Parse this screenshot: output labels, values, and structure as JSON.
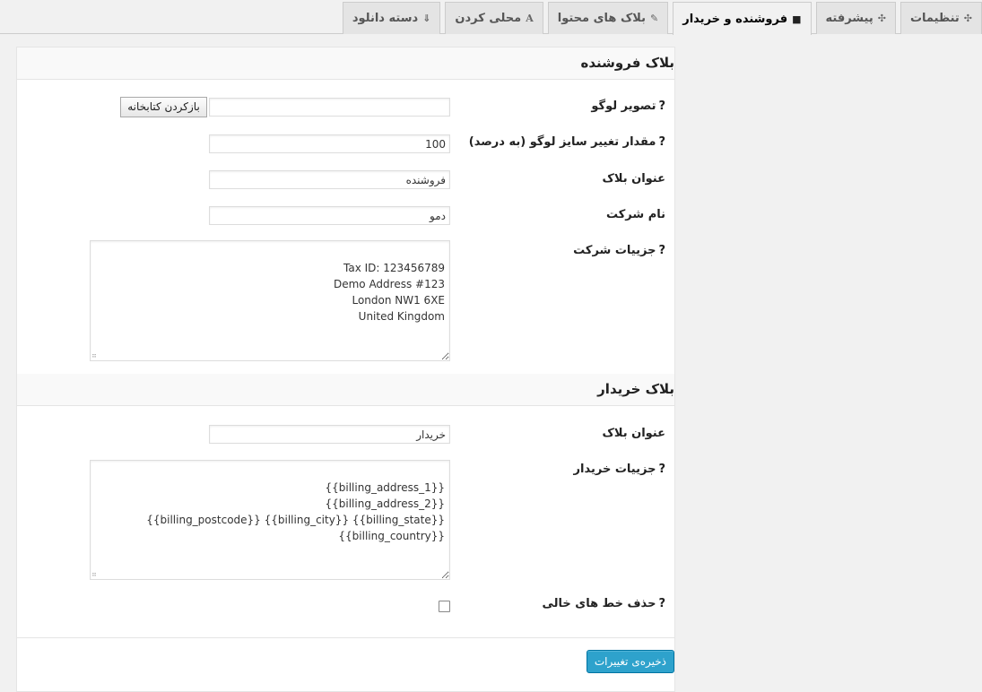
{
  "tabs": [
    {
      "label": "تنظیمات",
      "icon": "✣",
      "active": false
    },
    {
      "label": "پیشرفته",
      "icon": "✣",
      "active": false
    },
    {
      "label": "فروشنده و خریدار",
      "icon": "■",
      "active": true
    },
    {
      "label": "بلاک های محتوا",
      "icon": "✎",
      "active": false
    },
    {
      "label": "محلی کردن",
      "icon": "A",
      "active": false
    },
    {
      "label": "دسته دانلود",
      "icon": "⇓",
      "active": false
    }
  ],
  "seller": {
    "title": "بلاک فروشنده",
    "logo_label": "تصویر لوگو",
    "logo_value": "",
    "library_button": "بازکردن کتابخانه",
    "resize_label": "مقدار تغییر سایز لوگو (به درصد)",
    "resize_value": "100",
    "block_title_label": "عنوان بلاک",
    "block_title_value": "فروشنده",
    "company_name_label": "نام شرکت",
    "company_name_value": "دمو",
    "company_details_label": "جزییات شرکت",
    "company_details_value": "Tax ID: 123456789\nDemo Address #123\nLondon NW1 6XE\nUnited Kingdom"
  },
  "buyer": {
    "title": "بلاک خریدار",
    "block_title_label": "عنوان بلاک",
    "block_title_value": "خریدار",
    "buyer_details_label": "جزییات خریدار",
    "buyer_details_value": "{{billing_address_1}}\n{{billing_address_2}}\n{{billing_postcode}} {{billing_city}} {{billing_state}}\n{{billing_country}}",
    "remove_empty_label": "حذف خط های خالی",
    "remove_empty_checked": false
  },
  "save_button": "ذخیره‌ی تغییرات",
  "help_mark": "?",
  "colors": {
    "primary_button": "#2ea2cc",
    "tab_active_bg": "#f1f1f1",
    "tab_bg": "#e4e4e4"
  }
}
